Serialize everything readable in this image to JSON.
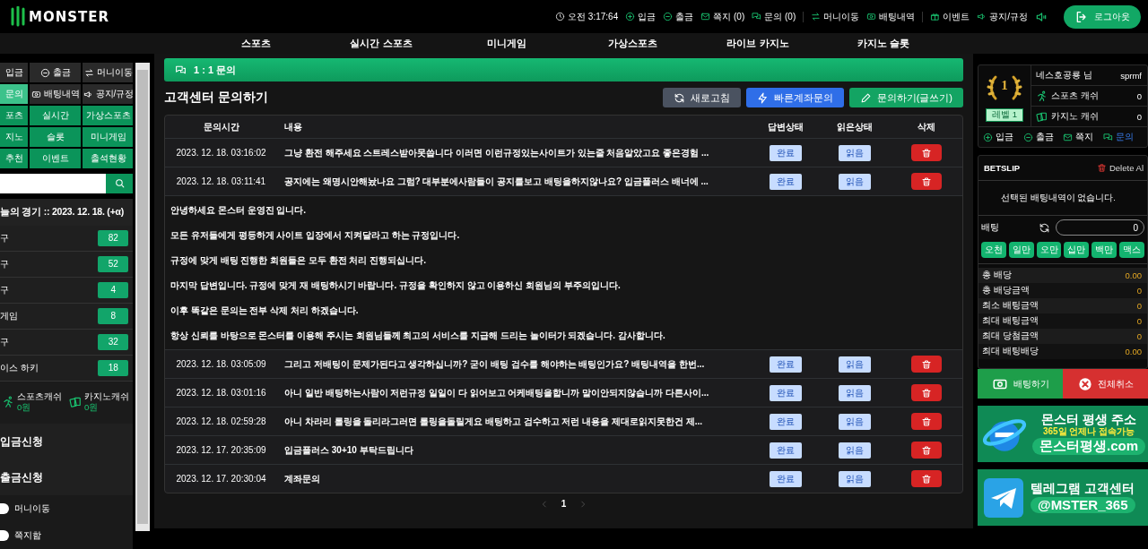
{
  "header": {
    "logo": "MONSTER",
    "clock": "오전 3:17:64",
    "link_groups": [
      [
        {
          "kind": "deposit",
          "label": "입금"
        },
        {
          "kind": "withdraw",
          "label": "출금"
        },
        {
          "kind": "message",
          "label": "쪽지 (0)"
        },
        {
          "kind": "inquiry",
          "label": "문의 (0)"
        }
      ],
      [
        {
          "kind": "transfer",
          "label": "머니이동"
        },
        {
          "kind": "history",
          "label": "배팅내역"
        }
      ],
      [
        {
          "kind": "event",
          "label": "이벤트"
        },
        {
          "kind": "notice",
          "label": "공지/규정"
        },
        {
          "kind": "sound"
        }
      ]
    ],
    "logout": "로그아웃"
  },
  "nav": [
    "스포츠",
    "실시간 스포츠",
    "미니게임",
    "가상스포츠",
    "라이브 카지노",
    "카지노 슬롯"
  ],
  "sidebar": {
    "quick": [
      {
        "kind": "deposit",
        "label": "입금",
        "selected": false
      },
      {
        "kind": "withdraw",
        "label": "출금",
        "selected": false
      },
      {
        "kind": "transfer",
        "label": "머니이동",
        "selected": false
      },
      {
        "kind": "inquiry",
        "label": "문의",
        "selected": true
      },
      {
        "kind": "history",
        "label": "배팅내역",
        "selected": false
      },
      {
        "kind": "notice",
        "label": "공지/규정",
        "selected": false
      },
      {
        "kind": "game",
        "label": "포츠",
        "selected": false
      },
      {
        "kind": "game",
        "label": "실시간",
        "selected": false
      },
      {
        "kind": "game",
        "label": "가상스포츠",
        "selected": false
      },
      {
        "kind": "game",
        "label": "지노",
        "selected": false
      },
      {
        "kind": "game",
        "label": "슬롯",
        "selected": false
      },
      {
        "kind": "game",
        "label": "미니게임",
        "selected": false
      },
      {
        "kind": "game",
        "label": "추천",
        "selected": false
      },
      {
        "kind": "game",
        "label": "이벤트",
        "selected": false
      },
      {
        "kind": "game",
        "label": "출석현황",
        "selected": false
      }
    ],
    "today_title": "늘의 경기 :: 2023. 12. 18. (+α)",
    "sports": [
      {
        "name": "구",
        "count": "82"
      },
      {
        "name": "구",
        "count": "52"
      },
      {
        "name": "구",
        "count": "4"
      },
      {
        "name": "게임",
        "count": "8"
      },
      {
        "name": "구",
        "count": "32"
      },
      {
        "name": "이스 하키",
        "count": "18"
      }
    ],
    "cash": [
      {
        "kind": "sports",
        "label": "스포츠캐쉬",
        "value": "0원"
      },
      {
        "kind": "casino",
        "label": "카지노캐쉬",
        "value": "0원"
      }
    ],
    "requests": [
      "입금신청",
      "출금신청"
    ],
    "menu": [
      "머니이동",
      "쪽지함"
    ]
  },
  "main": {
    "section_title": "1 : 1 문의",
    "title": "고객센터 문의하기",
    "buttons": [
      {
        "kind": "refresh",
        "label": "새로고침"
      },
      {
        "kind": "quick",
        "label": "빠른계좌문의"
      },
      {
        "kind": "write",
        "label": "문의하기(글쓰기)"
      }
    ],
    "table": {
      "columns": [
        "문의시간",
        "내용",
        "답변상태",
        "읽은상태",
        "삭제"
      ],
      "rows": [
        {
          "time": "2023. 12. 18. 03:16:02",
          "content": "그냥 환전 해주세요 스트레스받아못씁니다 이러면 이런규정있는사이트가 있는줄 처음알았고요 좋은경험 ...",
          "answer_status": "완료",
          "read_status": "읽음"
        },
        {
          "time": "2023. 12. 18. 03:11:41",
          "content": "공지에는 왜명시안해놨나요 그럼? 대부분에사람들이 공지를보고 배팅을하지않나요? 입금플러스 배너에 ...",
          "answer_status": "완료",
          "read_status": "읽음",
          "reply": [
            "안녕하세요 몬스터 운영진 입니다.",
            "모든 유저들에게 평등하게 사이트 입장에서 지켜달라고 하는 규정입니다.",
            "규정에 맞게 배팅 진행한 회원들은 모두 환전 처리 진행되십니다.",
            "마지막 답변입니다. 규정에 맞게 재 배팅하시기 바랍니다. 규정을 확인하지 않고 이용하신 회원님의 부주의입니다.",
            "이후 똑같은 문의는 전부 삭제 처리 하겠습니다.",
            "항상 신뢰를 바탕으로 몬스터를 이용해 주시는 회원님들께 최고의 서비스를 지급해 드리는 놀이터가 되겠습니다. 감사합니다."
          ]
        },
        {
          "time": "2023. 12. 18. 03:05:09",
          "content": "그리고 저배팅이 문제가된다고 생각하십니까? 굳이 배팅 검수를 해야하는 배팅인가요? 배팅내역을 한번...",
          "answer_status": "완료",
          "read_status": "읽음"
        },
        {
          "time": "2023. 12. 18. 03:01:16",
          "content": "아니 일반 배팅하는사람이 저런규정 일일이 다 읽어보고 어케배팅을합니까 말이안되지않습니까 다른사이...",
          "answer_status": "완료",
          "read_status": "읽음"
        },
        {
          "time": "2023. 12. 18. 02:59:28",
          "content": "아니 차라리 롤링을 돌리라그러면 롤링을돌릴게요 배팅하고 검수하고 저런 내용을 제대로읽지못한건 제...",
          "answer_status": "완료",
          "read_status": "읽음"
        },
        {
          "time": "2023. 12. 17. 20:35:09",
          "content": "입금플러스 30+10 부탁드립니다",
          "answer_status": "완료",
          "read_status": "읽음"
        },
        {
          "time": "2023. 12. 17. 20:30:04",
          "content": "계좌문의",
          "answer_status": "완료",
          "read_status": "읽음"
        }
      ]
    },
    "pagination": [
      {
        "label": "1",
        "selected": true
      }
    ]
  },
  "account": {
    "rank": "1",
    "level": "레벨 1",
    "username": "네스호공룡 님",
    "user_id": "sprmf",
    "balances": [
      {
        "kind": "sports",
        "label": "스포츠 캐쉬",
        "value": "0"
      },
      {
        "kind": "casino",
        "label": "카지노 캐쉬",
        "value": "0"
      }
    ],
    "actions": [
      {
        "kind": "deposit",
        "label": "입금",
        "selected": false
      },
      {
        "kind": "withdraw",
        "label": "출금",
        "selected": false
      },
      {
        "kind": "message",
        "label": "쪽지",
        "selected": false
      },
      {
        "kind": "inquiry",
        "label": "문의",
        "selected": true
      }
    ]
  },
  "betslip": {
    "title": "BETSLIP",
    "delete_all": "Delete Al",
    "empty": "선택된 배팅내역이 없습니다.",
    "bet_label": "배팅",
    "amount": "0",
    "chips": [
      "오천",
      "일만",
      "오만",
      "십만",
      "백만",
      "맥스"
    ],
    "stats": [
      {
        "label": "총 배당",
        "value": "0.00"
      },
      {
        "label": "총 배당금액",
        "value": "0"
      },
      {
        "label": "최소 배팅금액",
        "value": "0"
      },
      {
        "label": "최대 배팅금액",
        "value": "0"
      },
      {
        "label": "최대 당첨금액",
        "value": "0"
      },
      {
        "label": "최대 배팅배당",
        "value": "0.00"
      }
    ],
    "place": "배팅하기",
    "cancel": "전체취소"
  },
  "banners": [
    {
      "kind": "address",
      "title": "몬스터 평생 주소",
      "subtitle": "365일 언제나 접속가능",
      "link": "몬스터평생.com"
    },
    {
      "kind": "telegram",
      "title": "텔레그램 고객센터",
      "link": "@MSTER_365"
    }
  ]
}
